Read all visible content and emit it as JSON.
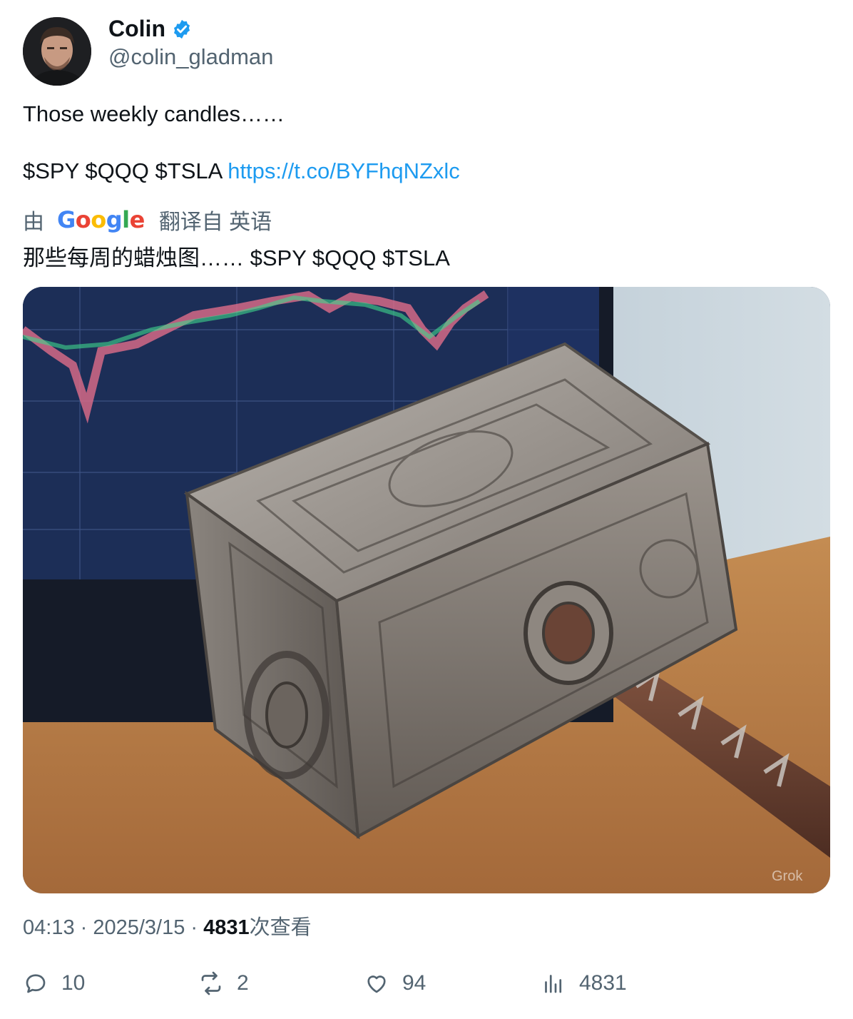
{
  "author": {
    "display_name": "Colin",
    "handle": "@colin_gladman",
    "verified": true,
    "avatar_icon": "user-avatar-photo"
  },
  "tweet": {
    "line1": "Those weekly candles……",
    "tickers": "$SPY $QQQ $TSLA ",
    "link": "https://t.co/BYFhqNZxlc"
  },
  "translation": {
    "by_label": "由",
    "provider": "Google",
    "from_label": "翻译自 英语",
    "text": "那些每周的蜡烛图…… $SPY $QQQ $TSLA"
  },
  "media": {
    "icon": "hammer-photo",
    "watermark": "Grok"
  },
  "meta": {
    "time": "04:13",
    "separator": " · ",
    "date": "2025/3/15",
    "views_count": "4831",
    "views_label": "次查看"
  },
  "actions": {
    "replies": "10",
    "reposts": "2",
    "likes": "94",
    "views": "4831"
  },
  "colors": {
    "link": "#1d9bf0",
    "secondary_text": "#536471",
    "verified": "#1d9bf0"
  }
}
